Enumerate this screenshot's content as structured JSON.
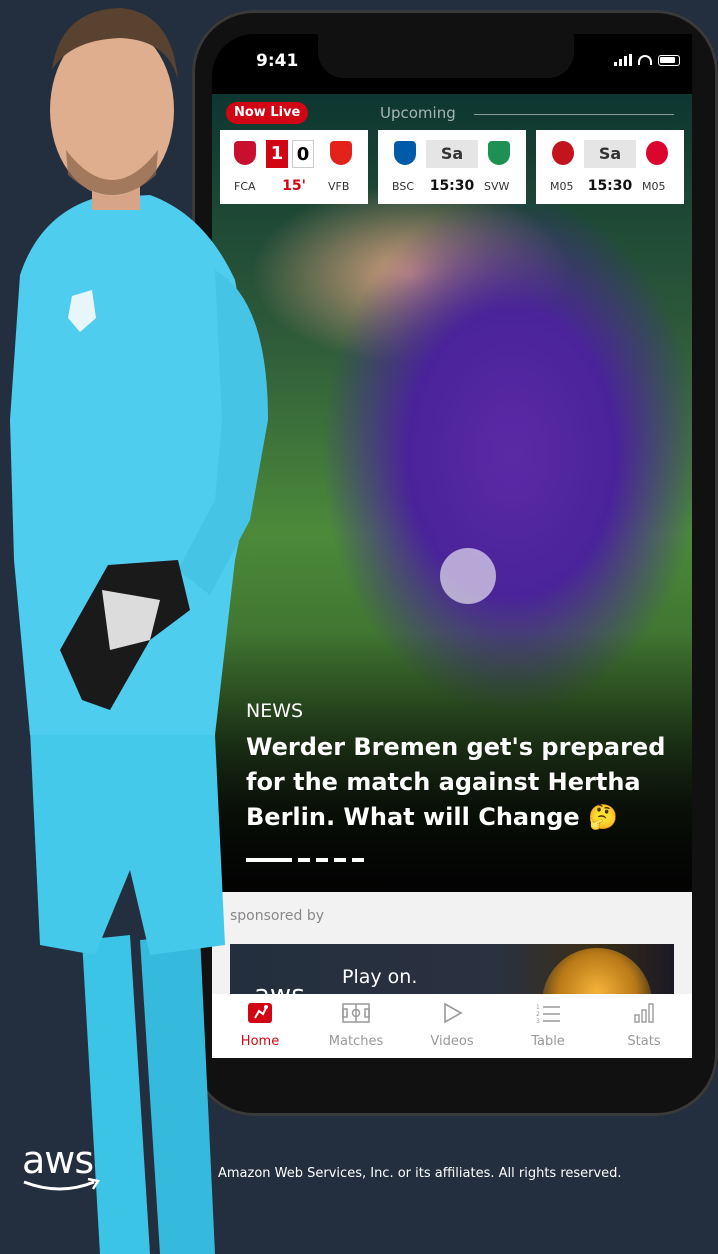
{
  "status_bar": {
    "time": "9:41"
  },
  "live_tabs": {
    "live_label": "Now Live",
    "upcoming_label": "Upcoming"
  },
  "matches": [
    {
      "home": "FCA",
      "away": "VFB",
      "home_score": "1",
      "away_score": "0",
      "minute": "15'",
      "home_color": "#c8102e",
      "away_color": "#e32219"
    },
    {
      "home": "BSC",
      "away": "SVW",
      "day": "Sa",
      "time": "15:30",
      "home_color": "#005ca9",
      "away_color": "#1d9053"
    },
    {
      "home": "M05",
      "away": "M05",
      "day": "Sa",
      "time": "15:30",
      "home_color": "#c3141e",
      "away_color": "#dc052d"
    }
  ],
  "hero": {
    "category": "NEWS",
    "headline": "Werder Bremen get's prepared for the match against Hertha Berlin. What will Change 🤔",
    "slides_total": 5,
    "slide_active": 1
  },
  "sponsor": {
    "label": "sponsored by",
    "ad_logo": "aws",
    "ad_text": "Play on."
  },
  "nav": {
    "items": [
      {
        "label": "Home",
        "icon": "bundesliga-icon",
        "active": true
      },
      {
        "label": "Matches",
        "icon": "pitch-icon"
      },
      {
        "label": "Videos",
        "icon": "play-icon"
      },
      {
        "label": "Table",
        "icon": "table-icon"
      },
      {
        "label": "Stats",
        "icon": "stats-icon"
      }
    ]
  },
  "footer": {
    "logo": "aws",
    "copyright": "Amazon Web Services, Inc. or its affiliates. All rights reserved."
  },
  "colors": {
    "background": "#232f3e",
    "accent": "#d20515"
  }
}
